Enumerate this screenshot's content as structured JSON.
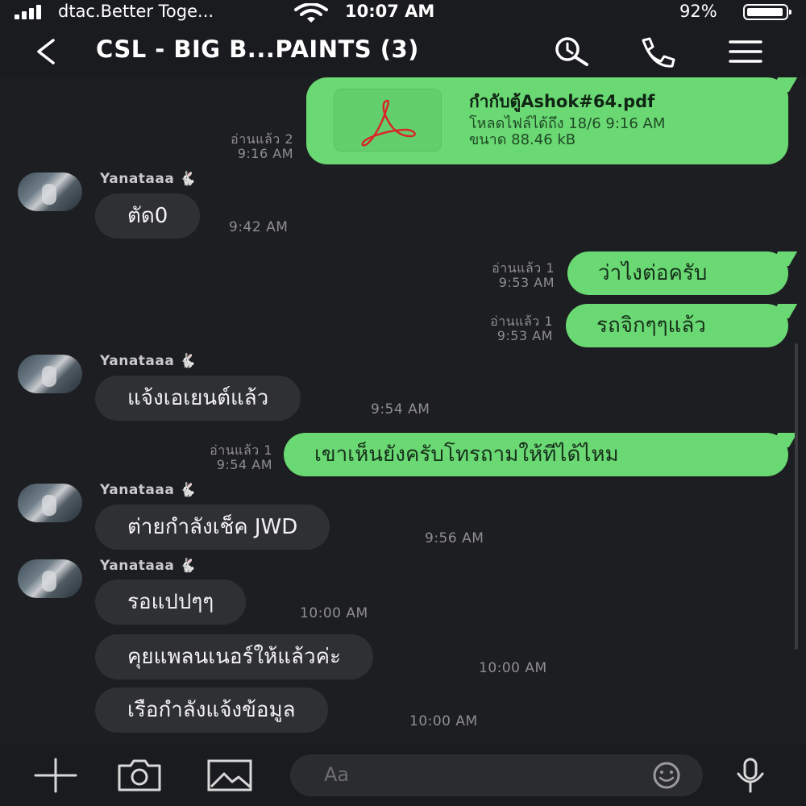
{
  "status": {
    "carrier": "dtac.Better Toge...",
    "time": "10:07 AM",
    "battery": "92%",
    "battery_level": 0.92
  },
  "header": {
    "title": "CSL - BIG B...PAINTS (3)",
    "icons": [
      "back-icon",
      "search-icon",
      "phone-icon",
      "menu-icon"
    ]
  },
  "file_message": {
    "filename": "กำกับตู้Ashok#64.pdf",
    "expires": "โหลดไฟล์ได้ถึง 18/6 9:16 AM",
    "size": "ขนาด 88.46 kB",
    "read": "อ่านแล้ว 2",
    "time": "9:16 AM",
    "icon": "pdf-icon"
  },
  "messages": [
    {
      "sender": "Yanataaa",
      "text": "ตัด0",
      "time": "9:42 AM"
    },
    {
      "text": "ว่าไงต่อครับ",
      "read": "อ่านแล้ว 1",
      "time": "9:53 AM"
    },
    {
      "text": "รถจิกๆๆแล้ว",
      "read": "อ่านแล้ว 1",
      "time": "9:53 AM"
    },
    {
      "sender": "Yanataaa",
      "text": "แจ้งเอเยนต์แล้ว",
      "time": "9:54 AM"
    },
    {
      "text": "เขาเห็นยังครับโทรถามให้ทีได้ไหม",
      "read": "อ่านแล้ว 1",
      "time": "9:54 AM"
    },
    {
      "sender": "Yanataaa",
      "text": "ต่ายกำลังเช็ค JWD",
      "time": "9:56 AM"
    },
    {
      "sender": "Yanataaa",
      "text": "รอแปปๆๆ",
      "time": "10:00 AM"
    },
    {
      "text": "คุยแพลนเนอร์ให้แล้วค่ะ",
      "time": "10:00 AM"
    },
    {
      "text": "เรือกำลังแจ้งข้อมูล",
      "time": "10:00 AM"
    }
  ],
  "input": {
    "placeholder": "Aa",
    "icons": [
      "plus-icon",
      "camera-icon",
      "image-icon",
      "emoji-icon",
      "microphone-icon"
    ]
  },
  "colors": {
    "background": "#1d1e21",
    "outgoing_bubble": "#6ad873",
    "incoming_bubble": "#2f3034"
  }
}
